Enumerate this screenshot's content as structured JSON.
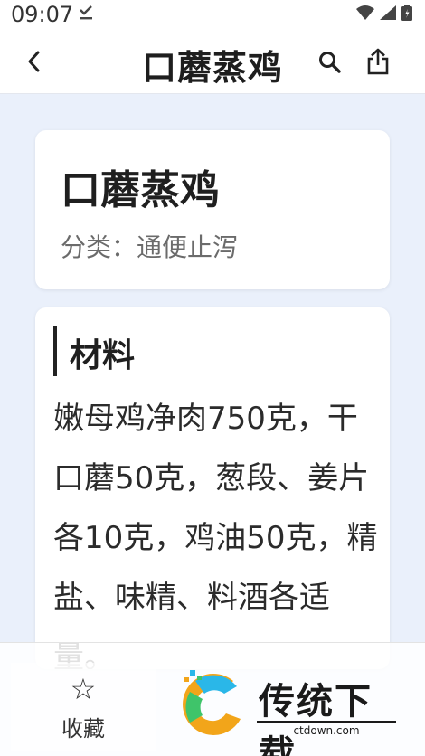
{
  "status_bar": {
    "time": "09:07"
  },
  "app_bar": {
    "title": "口蘑蒸鸡"
  },
  "recipe": {
    "name": "口蘑蒸鸡",
    "category_label": "分类：",
    "category_value": "通便止泻"
  },
  "ingredients": {
    "section_title": "材料",
    "text": "嫩母鸡净肉750克，干口蘑50克，葱段、姜片各10克，鸡油50克，精盐、味精、料酒各适量。"
  },
  "bottom_bar": {
    "favorite_label": "收藏"
  },
  "watermark": {
    "brand_text": "传统下载",
    "brand_url": "ctdown.com"
  }
}
